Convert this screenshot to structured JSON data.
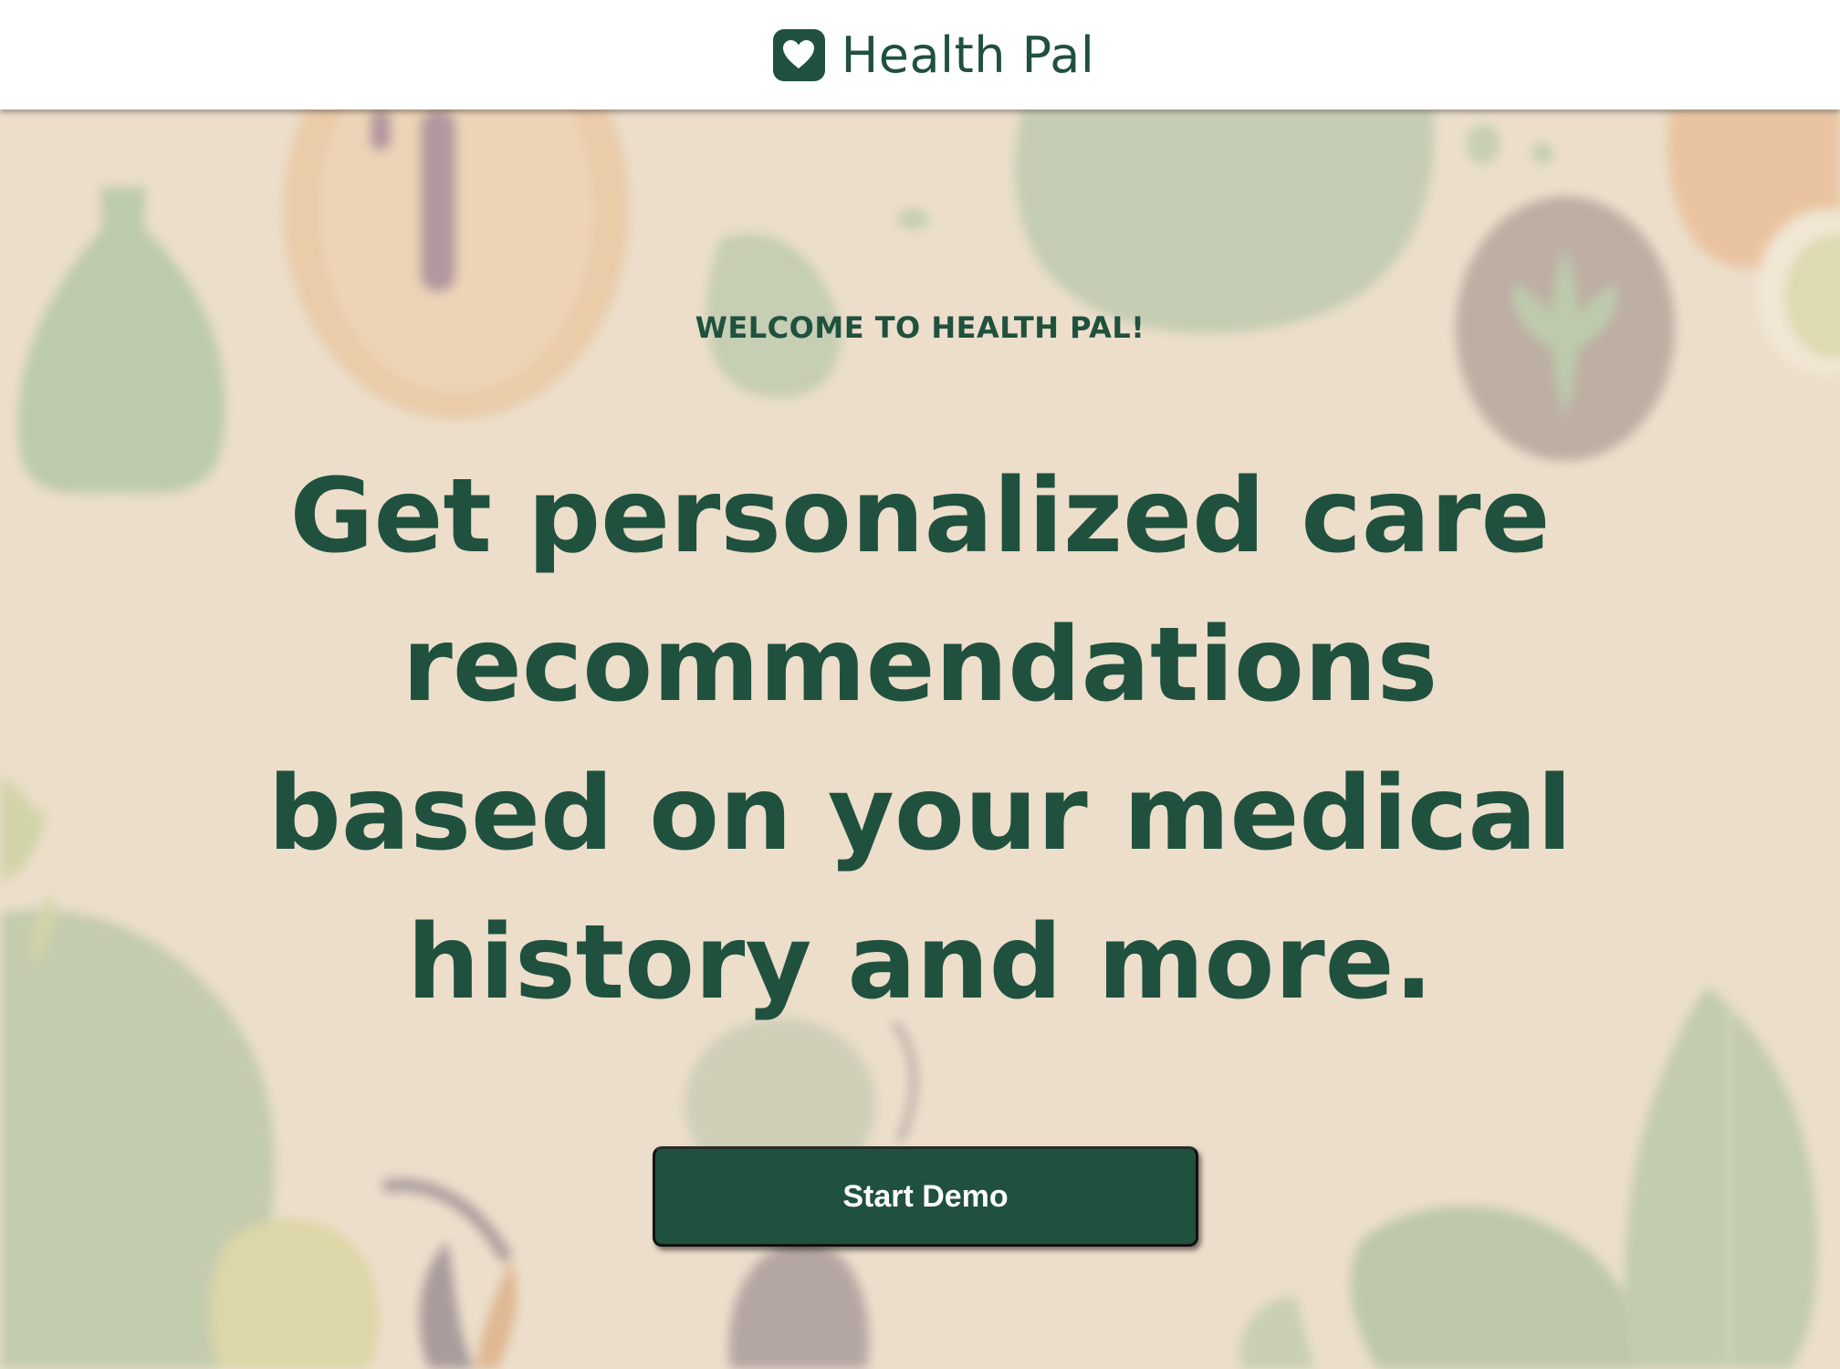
{
  "header": {
    "app_name": "Health Pal",
    "logo_icon": "heart-icon"
  },
  "hero": {
    "eyebrow": "WELCOME TO HEALTH PAL!",
    "headline": "Get personalized care recommendations based on your medical history and more.",
    "cta_label": "Start Demo"
  },
  "colors": {
    "brand_green": "#20513e",
    "background_beige": "#ecdfcb",
    "header_bg": "#ffffff",
    "button_text": "#ffffff"
  }
}
